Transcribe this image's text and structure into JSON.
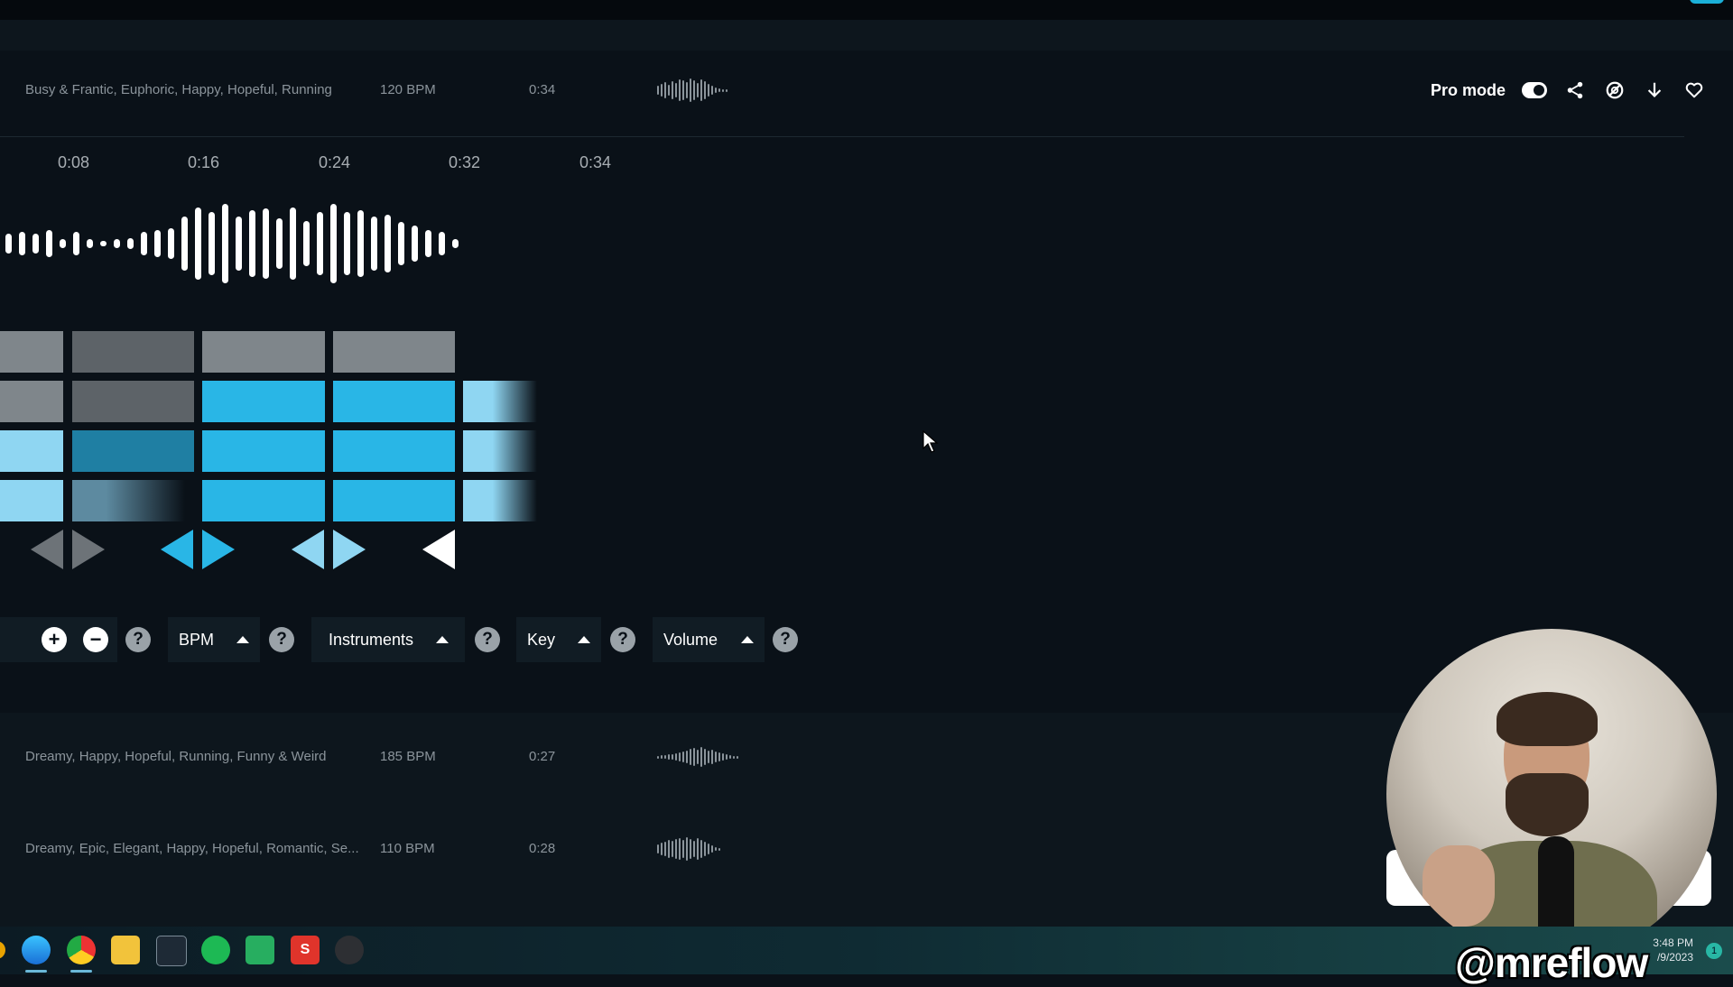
{
  "active_track": {
    "tags": "Busy & Frantic, Euphoric, Happy, Hopeful, Running",
    "bpm": "120 BPM",
    "duration": "0:34"
  },
  "header_controls": {
    "pro_mode_label": "Pro mode",
    "pro_mode_on": true,
    "icons": [
      "share-icon",
      "hide-icon",
      "download-icon",
      "favorite-icon"
    ]
  },
  "timeline": {
    "marks": [
      "0:08",
      "0:16",
      "0:24",
      "0:32",
      "0:34"
    ]
  },
  "toolbar": {
    "add_icon": "+",
    "remove_icon": "−",
    "help": "?",
    "bpm_label": "BPM",
    "instruments_label": "Instruments",
    "key_label": "Key",
    "volume_label": "Volume"
  },
  "tracks": [
    {
      "tags": "Dreamy, Happy, Hopeful, Running, Funny & Weird",
      "bpm": "185 BPM",
      "duration": "0:27"
    },
    {
      "tags": "Dreamy, Epic, Elegant, Happy, Hopeful, Romantic, Se...",
      "bpm": "110 BPM",
      "duration": "0:28"
    }
  ],
  "taskbar": {
    "apps": [
      "app-icon",
      "browser-icon",
      "file-explorer-icon",
      "calculator-icon",
      "music-icon",
      "sheets-icon",
      "slides-icon",
      "game-icon"
    ],
    "time": "3:48 PM",
    "date": "/9/2023",
    "notification_count": "1"
  },
  "overlay": {
    "handle": "@mreflow"
  },
  "colors": {
    "accent": "#29b6e6",
    "accent_light": "#8fd6f2",
    "grey": "#7f868b",
    "background": "#0a1118"
  }
}
